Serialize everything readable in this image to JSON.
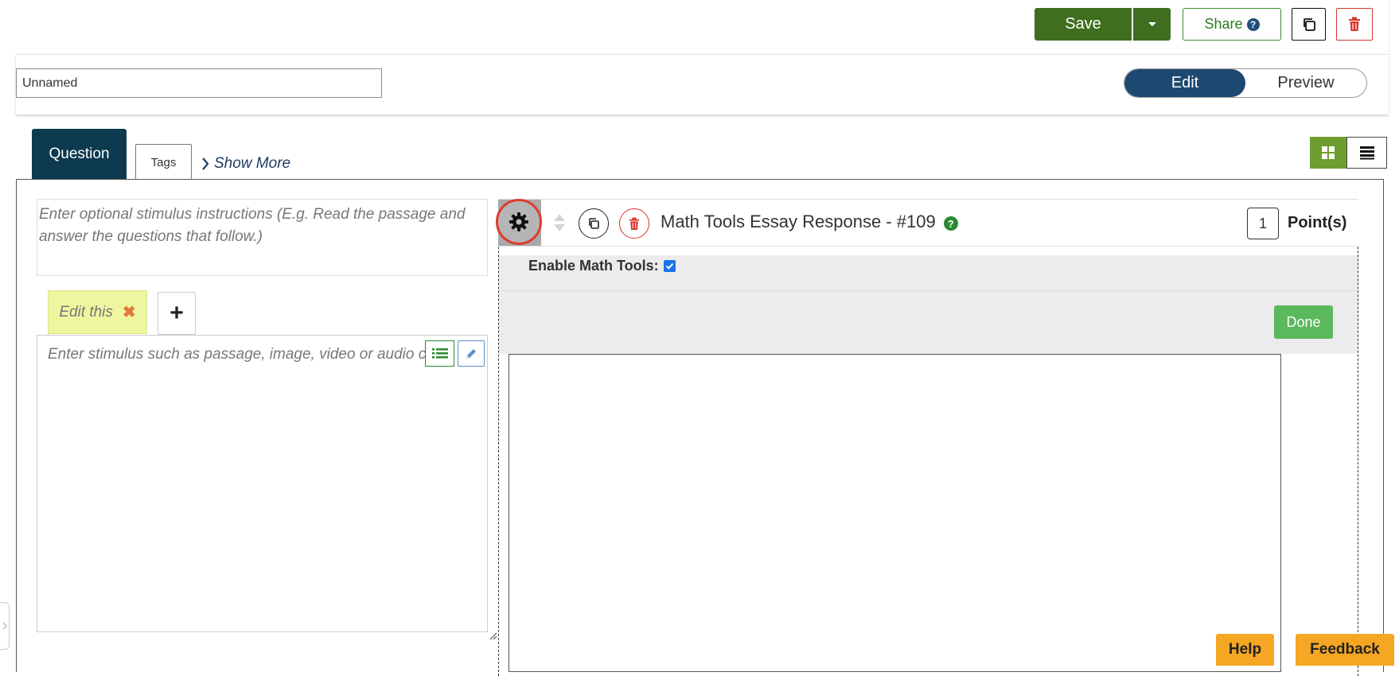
{
  "toolbar": {
    "save_label": "Save",
    "share_label": "Share",
    "share_help_glyph": "?",
    "icons": [
      "caret-down-icon",
      "question-circle-icon",
      "copy-icon",
      "trash-icon"
    ]
  },
  "item": {
    "name_value": "Unnamed"
  },
  "mode_toggle": {
    "edit_label": "Edit",
    "preview_label": "Preview",
    "active": "Edit"
  },
  "tabs": {
    "question_label": "Question",
    "tags_label": "Tags",
    "show_more_label": "Show More",
    "view_modes": [
      "grid-view-icon",
      "list-view-icon"
    ],
    "active_view": "grid"
  },
  "stimulus": {
    "instructions_placeholder": "Enter optional stimulus instructions (E.g. Read the passage and answer the questions that follow.)",
    "tab_label": "Edit this",
    "add_tab_glyph": "+",
    "body_placeholder": "Enter stimulus such as passage, image, video or audio clip"
  },
  "question": {
    "title": "Math Tools Essay Response - #109",
    "help_glyph": "?",
    "points_value": "1",
    "points_label": "Point(s)",
    "enable_math_tools_label": "Enable Math Tools:",
    "enable_math_tools_checked": true,
    "done_label": "Done"
  },
  "footer": {
    "help_label": "Help",
    "feedback_label": "Feedback"
  },
  "colors": {
    "save_green": "#3f6e1f",
    "toggle_active": "#1d4872",
    "question_tab": "#0d3a4e",
    "grid_active": "#6e9f2e",
    "done_green": "#5cb85c",
    "help_orange": "#f5a623",
    "danger_red": "#d6352b",
    "highlight_ring": "#e03a2f",
    "edit_tab_yellow": "#eef7a0"
  }
}
